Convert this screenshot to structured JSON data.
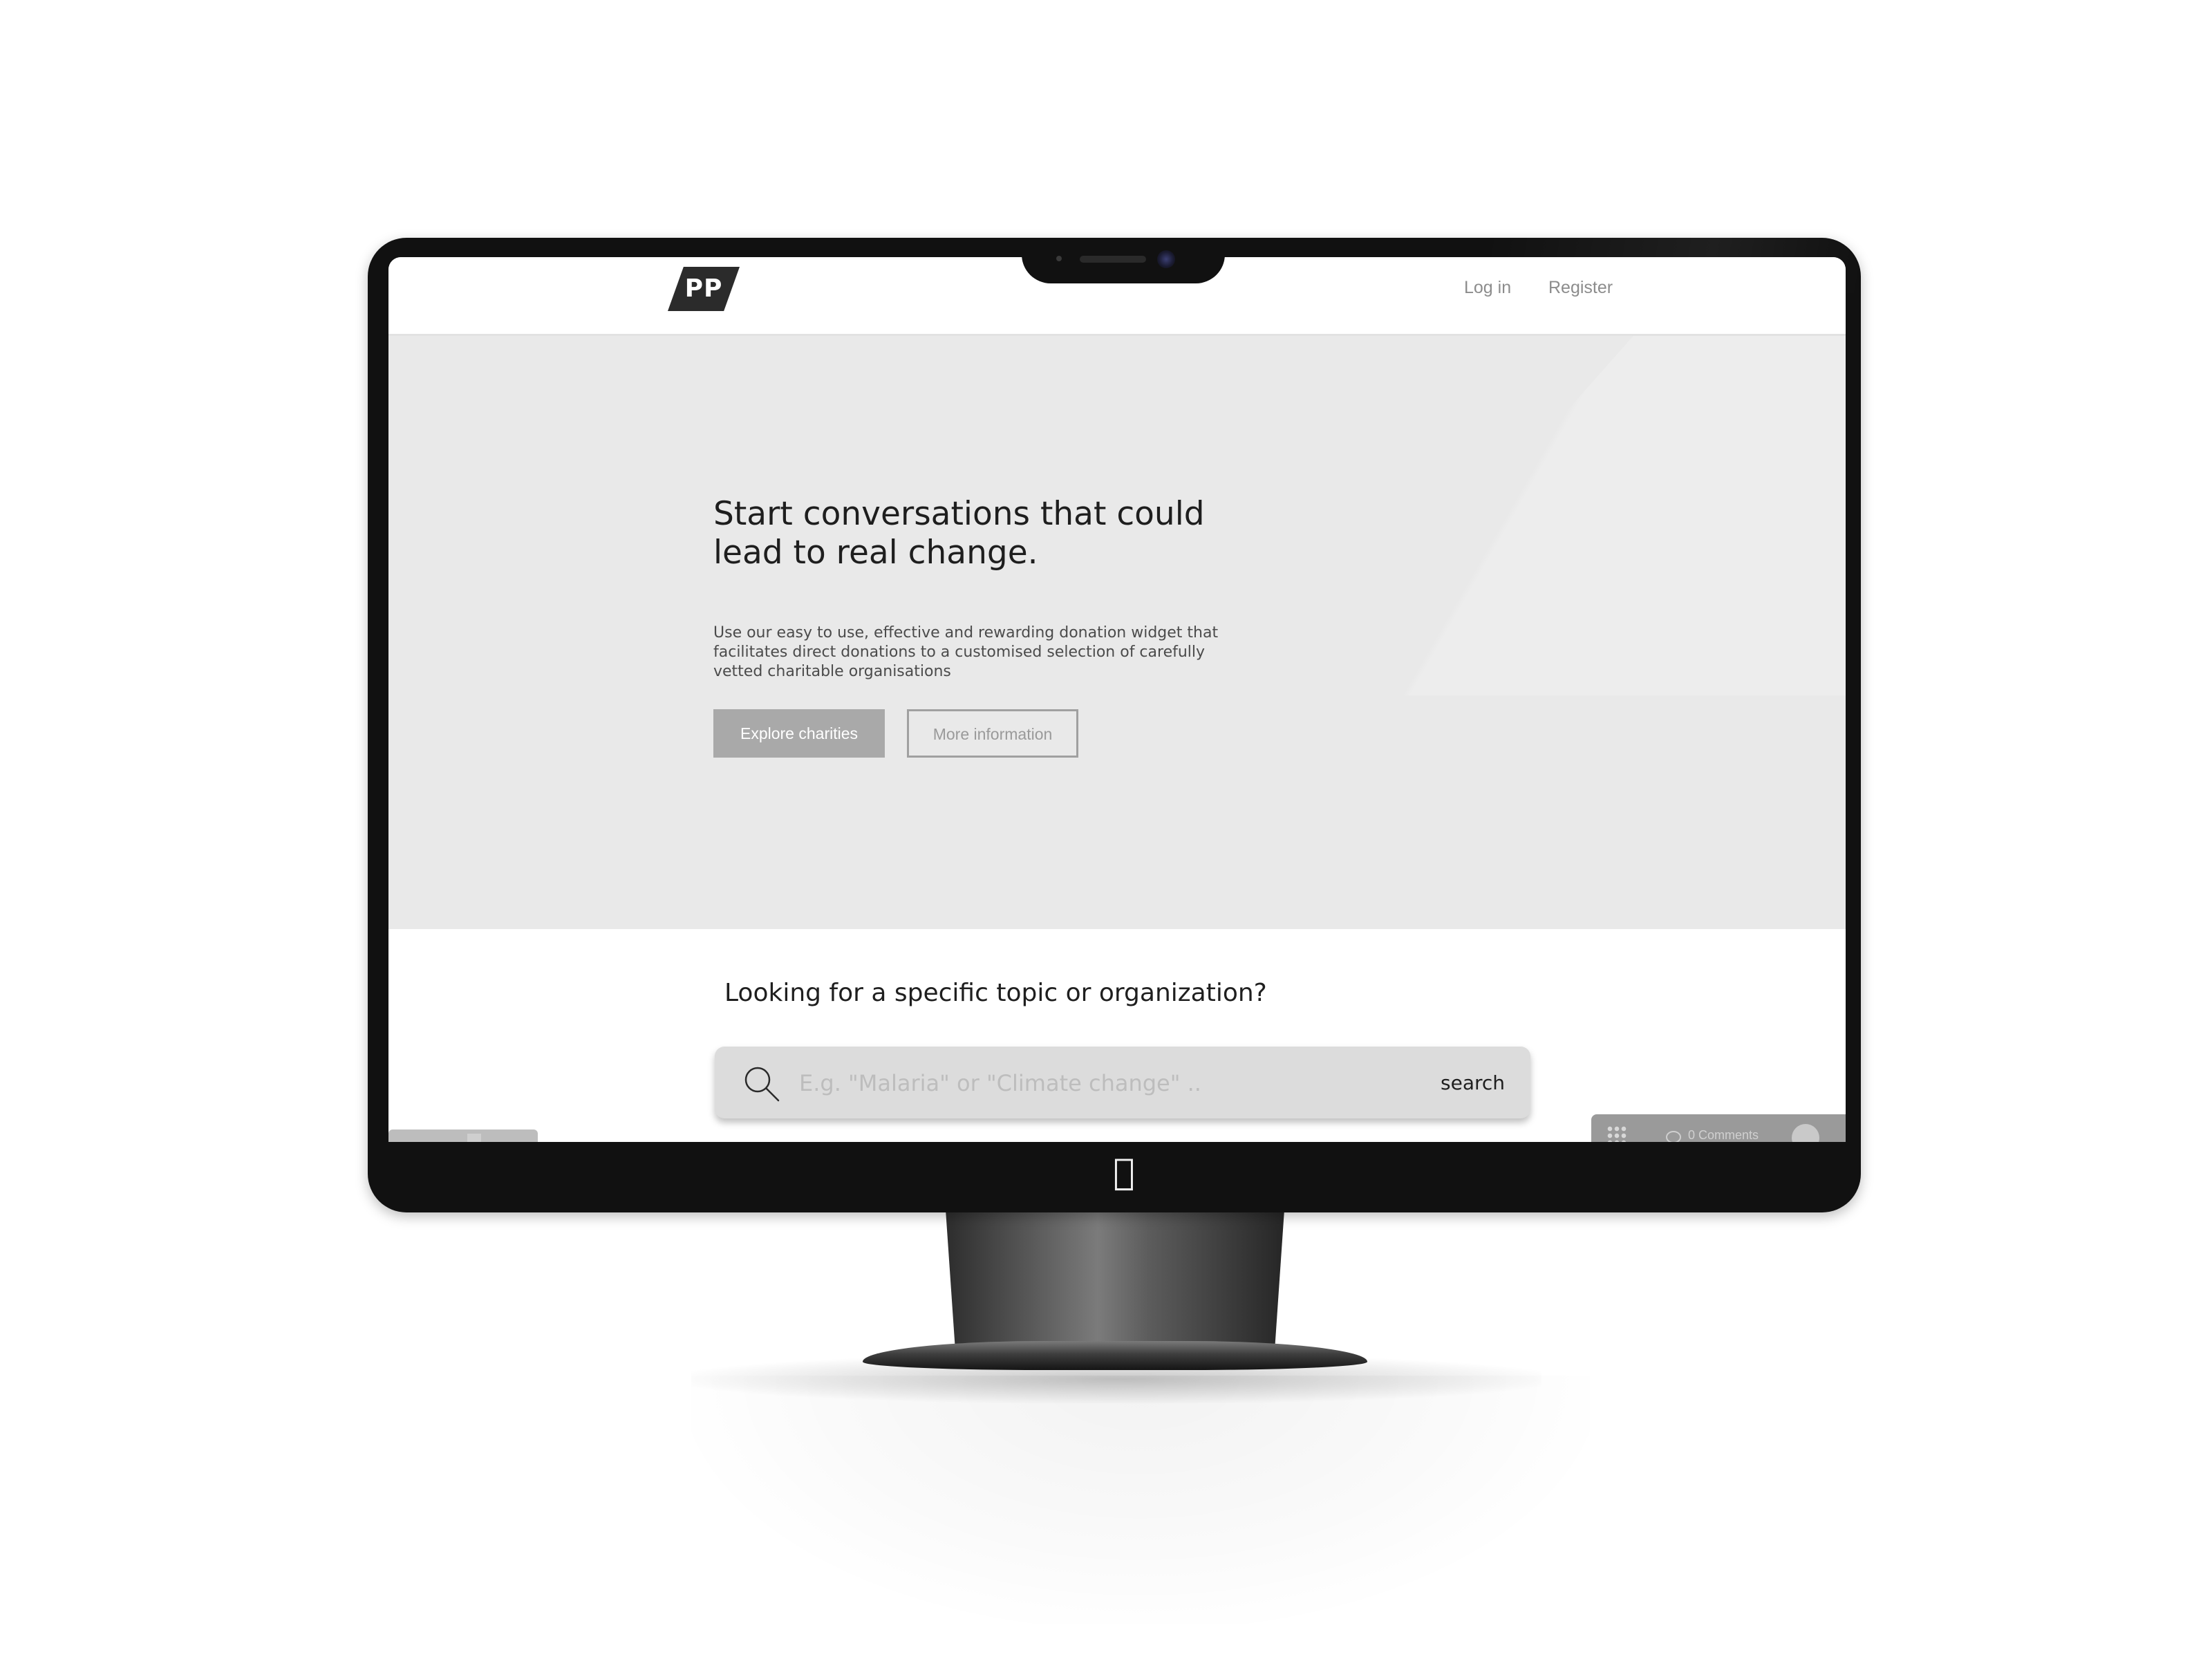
{
  "header": {
    "logo_text": "PP",
    "nav": {
      "login": "Log in",
      "register": "Register"
    }
  },
  "hero": {
    "title": "Start conversations that could lead to real change.",
    "description": "Use our easy to use, effective and rewarding donation widget that facilitates direct donations to a customised selection of carefully vetted charitable organisations",
    "primary_button": "Explore charities",
    "secondary_button": "More information"
  },
  "search": {
    "heading": "Looking for a specific topic or organization?",
    "placeholder": "E.g. \"Malaria\" or \"Climate change\" ..",
    "button_label": "search"
  },
  "comments_bar": {
    "label": "0 Comments"
  },
  "icons": {
    "brand": "apple-logo",
    "search": "search-icon",
    "comments": "comment-icon",
    "grid": "grid-icon"
  },
  "colors": {
    "hero_bg": "#e9e9e9",
    "primary_button": "#a9a9a9",
    "search_bar": "#dcdcdc",
    "text_dark": "#1e1e1e",
    "nav_text": "#8c8c8c"
  }
}
